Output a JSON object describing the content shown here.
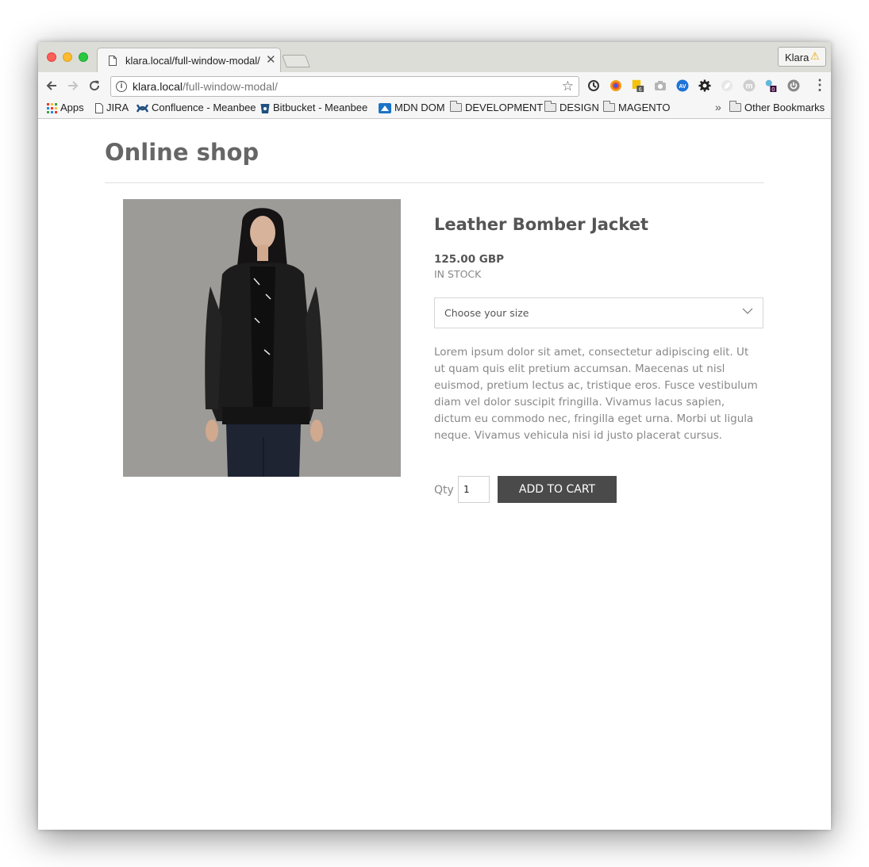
{
  "browser": {
    "tab": {
      "title": "klara.local/full-window-modal/",
      "close_glyph": "✕"
    },
    "profile": {
      "name": "Klara",
      "warning_glyph": "⚠"
    },
    "omnibox": {
      "host": "klara.local",
      "path": "/full-window-modal/"
    },
    "bookmarks": [
      {
        "label": "Apps",
        "icon": "apps-grid-icon"
      },
      {
        "label": "JIRA",
        "icon": "page-icon"
      },
      {
        "label": "Confluence - Meanbee",
        "icon": "confluence-icon"
      },
      {
        "label": "Bitbucket - Meanbee",
        "icon": "bitbucket-icon"
      },
      {
        "label": "MDN DOM",
        "icon": "mdn-icon"
      },
      {
        "label": "DEVELOPMENT",
        "icon": "folder-icon"
      },
      {
        "label": "DESIGN",
        "icon": "folder-icon"
      },
      {
        "label": "MAGENTO",
        "icon": "folder-icon"
      },
      {
        "label": "Other Bookmarks",
        "icon": "folder-icon"
      }
    ],
    "bookmarks_overflow": "»",
    "extension_badges": {
      "sheets": "6",
      "slack": "0"
    }
  },
  "page": {
    "title": "Online shop",
    "product": {
      "name": "Leather Bomber Jacket",
      "price": "125.00 GBP",
      "stock": "IN STOCK",
      "size_placeholder": "Choose your size",
      "description": "Lorem ipsum dolor sit amet, consectetur adipiscing elit. Ut ut quam quis elit pretium accumsan. Maecenas ut nisl euismod, pretium lectus ac, tristique eros. Fusce vestibulum diam vel dolor suscipit fringilla. Vivamus lacus sapien, dictum eu commodo nec, fringilla eget urna. Morbi ut ligula neque. Vivamus vehicula nisi id justo placerat cursus.",
      "qty_label": "Qty",
      "qty_value": "1",
      "add_to_cart": "ADD TO CART"
    }
  }
}
